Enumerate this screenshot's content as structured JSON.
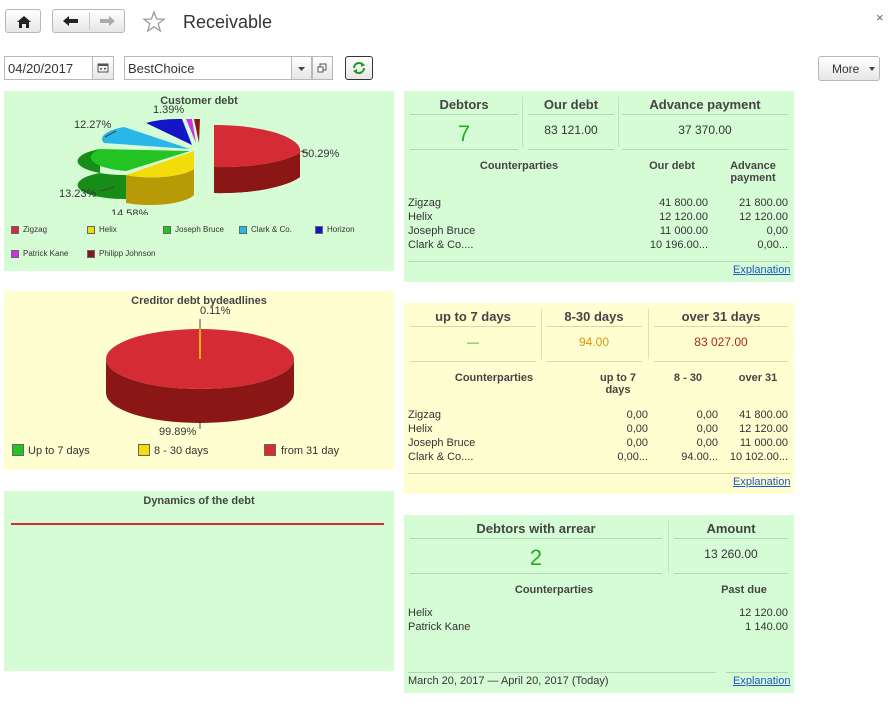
{
  "header": {
    "title": "Receivable",
    "close_glyph": "×",
    "icons": [
      "home-icon",
      "arrow-left-icon",
      "arrow-right-icon",
      "star-icon"
    ]
  },
  "filters": {
    "date": "04/20/2017",
    "company": "BestChoice",
    "more_label": "More"
  },
  "customer_chart": {
    "title": "Customer debt",
    "slice_labels": [
      "50.29%",
      "14.58%",
      "13.23%",
      "12.27%",
      "1.39%"
    ],
    "legend": [
      "Zigzag",
      "Helix",
      "Joseph Bruce",
      "Clark & Co.",
      "Horizon",
      "Patrick Kane",
      "Philipp Johnson"
    ],
    "colors": [
      "#d42b35",
      "#f2dc0a",
      "#22c322",
      "#29b6e8",
      "#1414c8",
      "#cc33e6",
      "#8a1616"
    ]
  },
  "chart_data": [
    {
      "type": "pie",
      "title": "Customer debt",
      "categories": [
        "Zigzag",
        "Helix",
        "Joseph Bruce",
        "Clark & Co.",
        "Horizon",
        "Patrick Kane",
        "Philipp Johnson"
      ],
      "values": [
        50.29,
        14.58,
        13.23,
        12.27,
        6.8,
        1.39,
        1.44
      ],
      "legend": "bottom"
    },
    {
      "type": "pie",
      "title": "Creditor  debt bydeadlines",
      "categories": [
        "Up to 7 days",
        "8 - 30 days",
        "from 31 day"
      ],
      "values": [
        0,
        0.11,
        99.89
      ],
      "legend": "bottom"
    },
    {
      "type": "line",
      "title": "Dynamics of the debt",
      "series": [
        {
          "values": [
            1,
            1
          ]
        }
      ]
    }
  ],
  "creditor_chart": {
    "title": "Creditor  debt bydeadlines",
    "slice_labels": [
      "0.11%",
      "99.89%"
    ],
    "legend": [
      "Up to 7 days",
      "8 - 30 days",
      "from 31 day"
    ],
    "colors": [
      "#22c322",
      "#f2dc0a",
      "#d42b35"
    ]
  },
  "dynamics_chart": {
    "title": "Dynamics of the debt",
    "line_color": "#d42b35"
  },
  "debtors_panel": {
    "headers": [
      "Debtors",
      "Our debt",
      "Advance payment"
    ],
    "values": [
      "7",
      "83 121.00",
      "37 370.00"
    ],
    "columns": [
      "Counterparties",
      "Our debt",
      "Advance payment"
    ],
    "rows": [
      [
        "Zigzag",
        "41 800.00",
        "21 800.00"
      ],
      [
        "Helix",
        "12 120.00",
        "12 120.00"
      ],
      [
        "Joseph Bruce",
        "11 000.00",
        "0,00"
      ],
      [
        "Clark & Co....",
        "10 196.00...",
        "0,00..."
      ]
    ],
    "link": "Explanation"
  },
  "deadlines_panel": {
    "headers": [
      "up to 7 days",
      "8-30 days",
      "over 31 days"
    ],
    "values": [
      "—",
      "94.00",
      "83 027.00"
    ],
    "value_colors": [
      "#21b021",
      "#d49a12",
      "#b0281a"
    ],
    "columns": [
      "Counterparties",
      "up to 7 days",
      "8 - 30",
      "over 31"
    ],
    "rows": [
      [
        "Zigzag",
        "0,00",
        "0,00",
        "41 800.00"
      ],
      [
        "Helix",
        "0,00",
        "0,00",
        "12 120.00"
      ],
      [
        "Joseph Bruce",
        "0,00",
        "0,00",
        "11 000.00"
      ],
      [
        "Clark & Co....",
        "0,00...",
        "94.00...",
        "10 102.00..."
      ]
    ],
    "link": "Explanation"
  },
  "arrear_panel": {
    "headers": [
      "Debtors with arrear",
      "Amount"
    ],
    "values": [
      "2",
      "13 260.00"
    ],
    "columns": [
      "Counterparties",
      "Past due"
    ],
    "rows": [
      [
        "Helix",
        "12 120.00"
      ],
      [
        "Patrick Kane",
        "1 140.00"
      ]
    ],
    "period": "March 20, 2017 — April 20, 2017 (Today)",
    "link": "Explanation"
  }
}
